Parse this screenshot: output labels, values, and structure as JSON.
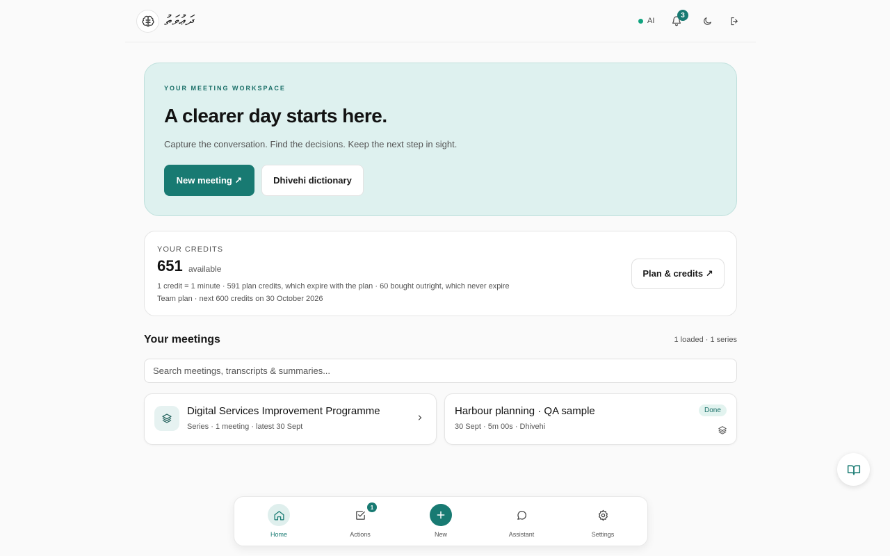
{
  "header": {
    "brand": "ދަޢުވަތު",
    "ai_label": "AI",
    "notification_count": "3"
  },
  "hero": {
    "eyebrow": "YOUR MEETING WORKSPACE",
    "title": "A clearer day starts here.",
    "subtitle": "Capture the conversation. Find the decisions. Keep the next step in sight.",
    "primary_button": "New meeting ↗",
    "secondary_button": "Dhivehi dictionary"
  },
  "credits": {
    "label": "YOUR CREDITS",
    "amount": "651",
    "available_label": "available",
    "line1": "1 credit = 1 minute · 591 plan credits, which expire with the plan · 60 bought outright, which never expire",
    "line2": "Team plan · next 600 credits on 30 October 2026",
    "plan_button": "Plan & credits ↗"
  },
  "meetings": {
    "title": "Your meetings",
    "count": "1 loaded · 1 series",
    "search_placeholder": "Search meetings, transcripts & summaries...",
    "cards": [
      {
        "title": "Digital Services Improvement Programme",
        "meta": "Series · 1 meeting · latest 30 Sept"
      },
      {
        "title": "Harbour planning · QA sample",
        "meta": "30 Sept · 5m 00s · Dhivehi",
        "status": "Done"
      }
    ]
  },
  "nav": {
    "items": [
      {
        "label": "Home"
      },
      {
        "label": "Actions",
        "badge": "1"
      },
      {
        "label": "New"
      },
      {
        "label": "Assistant"
      },
      {
        "label": "Settings"
      }
    ]
  },
  "colors": {
    "accent": "#187a72",
    "hero_bg": "#def1ef",
    "status_green": "#10a37f"
  }
}
